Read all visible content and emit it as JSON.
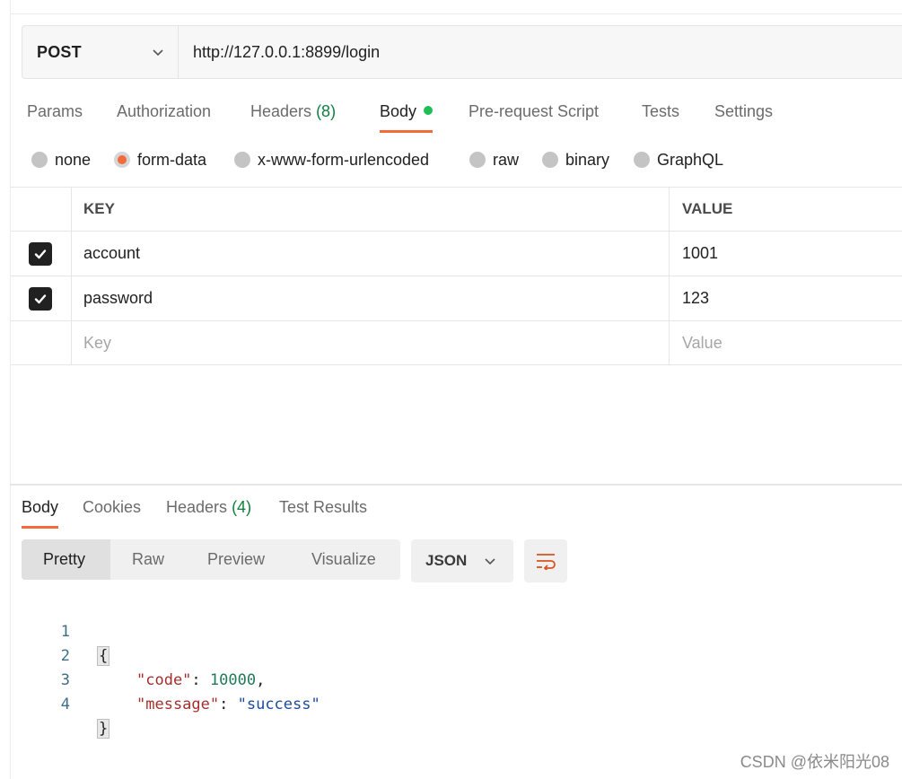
{
  "request": {
    "method": "POST",
    "url": "http://127.0.0.1:8899/login"
  },
  "request_tabs": [
    {
      "label": "Params"
    },
    {
      "label": "Authorization"
    },
    {
      "label": "Headers",
      "count": "(8)"
    },
    {
      "label": "Body"
    },
    {
      "label": "Pre-request Script"
    },
    {
      "label": "Tests"
    },
    {
      "label": "Settings"
    }
  ],
  "body_types": [
    "none",
    "form-data",
    "x-www-form-urlencoded",
    "raw",
    "binary",
    "GraphQL"
  ],
  "body_type_selected": "form-data",
  "params_table": {
    "headers": {
      "key": "KEY",
      "value": "VALUE"
    },
    "rows": [
      {
        "key": "account",
        "value": "1001",
        "checked": true
      },
      {
        "key": "password",
        "value": "123",
        "checked": true
      }
    ],
    "placeholder_key": "Key",
    "placeholder_value": "Value"
  },
  "response_tabs": [
    {
      "label": "Body"
    },
    {
      "label": "Cookies"
    },
    {
      "label": "Headers",
      "count": "(4)"
    },
    {
      "label": "Test Results"
    }
  ],
  "view_modes": [
    "Pretty",
    "Raw",
    "Preview",
    "Visualize"
  ],
  "format": "JSON",
  "response_code": {
    "line_numbers": [
      "1",
      "2",
      "3",
      "4"
    ],
    "open_brace": "{",
    "close_brace": "}",
    "key1": "\"code\"",
    "val1": "10000",
    "key2": "\"message\"",
    "val2": "\"success\""
  },
  "watermark": "CSDN @依米阳光08",
  "colors": {
    "accent": "#f26b3a",
    "green_dot": "#1fbf55",
    "count_green": "#0f8040"
  },
  "icons": [
    "chevron-down-icon",
    "check-icon",
    "wrap-lines-icon"
  ]
}
